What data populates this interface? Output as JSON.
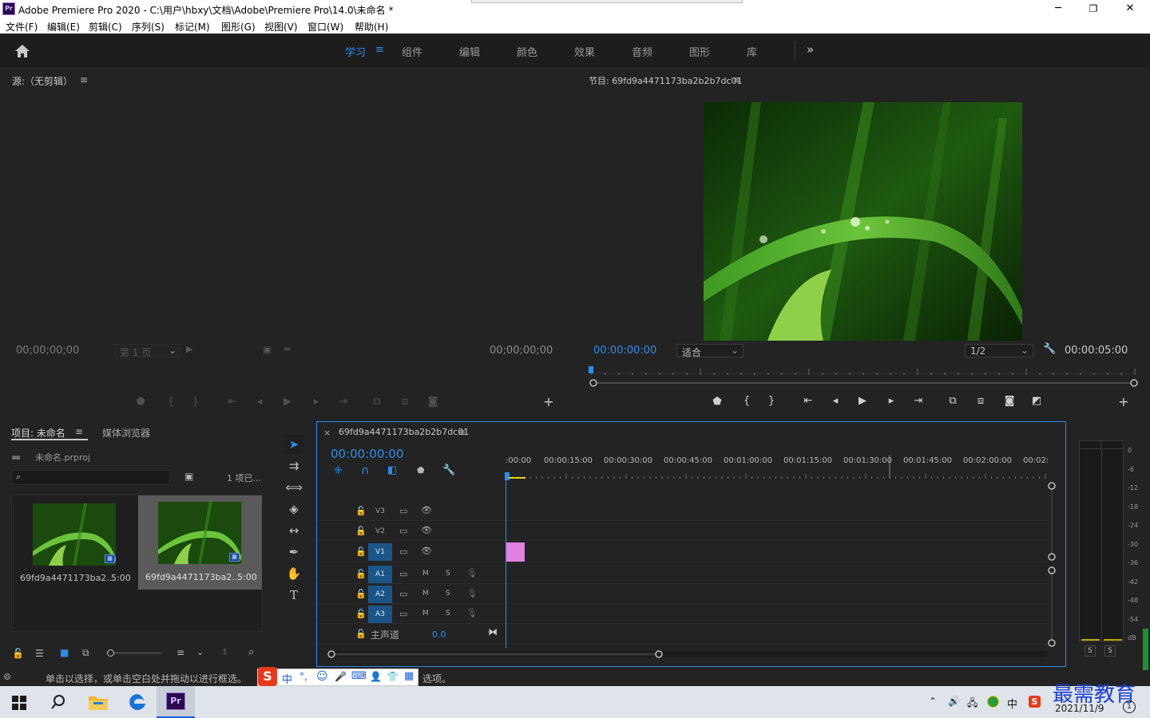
{
  "window": {
    "title": "Adobe Premiere Pro 2020 - C:\\用户\\hbxy\\文档\\Adobe\\Premiere Pro\\14.0\\未命名 *",
    "app_badge": "Pr",
    "minimize": "─",
    "restore": "❐",
    "close": "✕"
  },
  "menu": [
    "文件(F)",
    "编辑(E)",
    "剪辑(C)",
    "序列(S)",
    "标记(M)",
    "图形(G)",
    "视图(V)",
    "窗口(W)",
    "帮助(H)"
  ],
  "workspaces": {
    "tabs": [
      "学习",
      "组件",
      "编辑",
      "颜色",
      "效果",
      "音频",
      "图形",
      "库"
    ],
    "active": "学习",
    "more": "»"
  },
  "source_monitor": {
    "title": "源:（无剪辑）",
    "timecode_left": "00;00;00;00",
    "page_select": "第 1 页",
    "timecode_right": "00;00;00;00"
  },
  "program_monitor": {
    "title": "节目: 69fd9a4471173ba2b2b7dc01",
    "timecode": "00:00:00:00",
    "fit_select": "适合",
    "resolution_select": "1/2",
    "duration": "00:00:05:00"
  },
  "project_panel": {
    "tab_project": "项目: 未命名",
    "tab_media_browser": "媒体浏览器",
    "project_file": "未命名.prproj",
    "items_count": "1 项已...",
    "items": [
      {
        "name": "69fd9a4471173ba2...",
        "duration": "5:00",
        "selected": false
      },
      {
        "name": "69fd9a4471173ba2...",
        "duration": "5:00",
        "selected": true
      }
    ]
  },
  "timeline": {
    "sequence_tab": "69fd9a4471173ba2b2b7dc01",
    "close": "×",
    "timecode": "00:00:00:00",
    "ruler": [
      ":00:00",
      "00:00:15:00",
      "00:00:30:00",
      "00:00:45:00",
      "00:01:00:00",
      "00:01:15:00",
      "00:01:30:00",
      "00:01:45:00",
      "00:02:00:00",
      "00:02:"
    ],
    "video_tracks": [
      "V3",
      "V2",
      "V1"
    ],
    "audio_tracks": [
      "A1",
      "A2",
      "A3"
    ],
    "mute": "M",
    "solo": "S",
    "master_track": "主声道",
    "master_value": "0.0",
    "clip_color": "#e080e0"
  },
  "audio_meter": {
    "db_ticks": [
      "0",
      "-6",
      "-12",
      "-18",
      "-24",
      "-30",
      "-36",
      "-42",
      "-48",
      "-54",
      "dB"
    ],
    "solo_buttons": [
      "S",
      "S"
    ]
  },
  "status_bar": {
    "text": "单击以选择，或单击空白处并拖动以进行框选。",
    "text_tail": "选项。"
  },
  "ime": {
    "items": [
      "中",
      "°,",
      "☺",
      "🎤",
      "⌨",
      "👤",
      "👕",
      "▦"
    ]
  },
  "taskbar": {
    "date": "2021/11/9",
    "watermark": "最需教育",
    "tray_cn": "中",
    "tray_count": "1"
  }
}
